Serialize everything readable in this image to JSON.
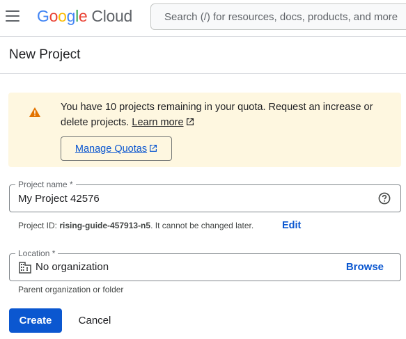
{
  "header": {
    "logo_letters": [
      "G",
      "o",
      "o",
      "g",
      "l",
      "e"
    ],
    "logo_product": "Cloud",
    "search_placeholder": "Search (/) for resources, docs, products, and more"
  },
  "page": {
    "title": "New Project"
  },
  "notice": {
    "text": "You have 10 projects remaining in your quota. Request an increase or delete projects.",
    "learn_more": "Learn more",
    "manage_quotas": "Manage Quotas",
    "warning_color": "#e37400"
  },
  "project_name": {
    "label": "Project name *",
    "value": "My Project 42576"
  },
  "project_id": {
    "prefix": "Project ID:",
    "id": "rising-guide-457913-n5",
    "suffix": ". It cannot be changed later.",
    "edit_label": "Edit"
  },
  "location": {
    "label": "Location *",
    "value": "No organization",
    "browse_label": "Browse",
    "hint": "Parent organization or folder"
  },
  "actions": {
    "create_label": "Create",
    "cancel_label": "Cancel"
  },
  "colors": {
    "primary": "#0b57d0",
    "notice_bg": "#fef7e0"
  }
}
